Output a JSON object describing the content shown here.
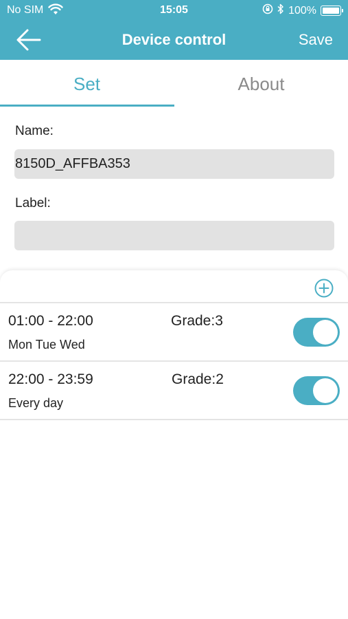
{
  "status_bar": {
    "carrier": "No SIM",
    "time": "15:05",
    "battery": "100%",
    "battery_level": 1.0
  },
  "nav": {
    "title": "Device control",
    "save_label": "Save",
    "back_icon": "arrow-left-icon"
  },
  "tabs": [
    {
      "label": "Set",
      "active": true
    },
    {
      "label": "About",
      "active": false
    }
  ],
  "form": {
    "name_label": "Name:",
    "name_value": "8150D_AFFBA353",
    "label_label": "Label:",
    "label_value": ""
  },
  "schedule": {
    "add_icon": "plus-circle-icon",
    "items": [
      {
        "time": "01:00 - 22:00",
        "grade": "Grade:3",
        "days": "Mon Tue Wed",
        "enabled": true
      },
      {
        "time": "22:00 - 23:59",
        "grade": "Grade:2",
        "days": "Every day",
        "enabled": true
      }
    ]
  },
  "colors": {
    "accent": "#4aaec4",
    "field_bg": "#e2e2e2"
  }
}
